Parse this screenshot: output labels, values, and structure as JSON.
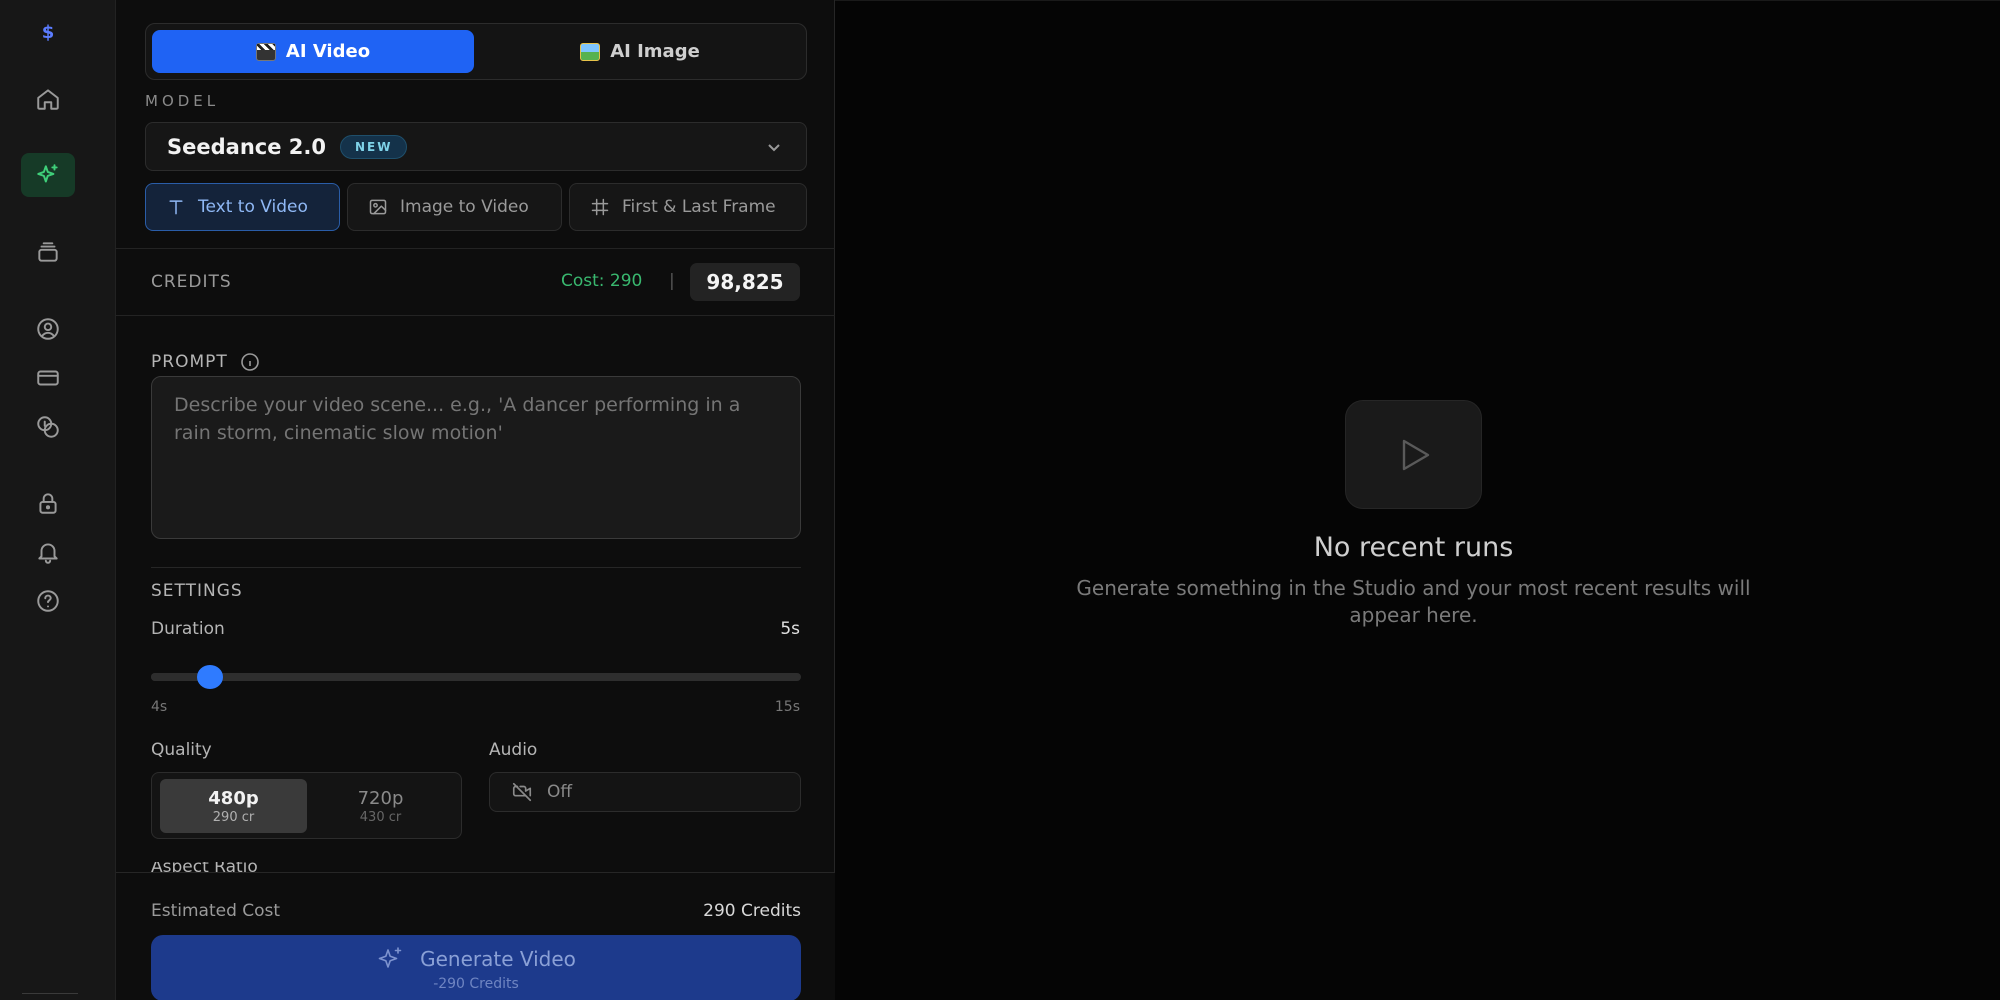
{
  "rail": {
    "logo": "$",
    "icons": [
      "home-icon",
      "sparkles-icon",
      "layers-icon",
      "user-circle-icon",
      "credit-card-icon",
      "coins-icon",
      "lock-icon",
      "bell-icon",
      "help-circle-icon"
    ],
    "active": "sparkles-icon",
    "active_color": "#3fd07a"
  },
  "mode_switch": {
    "video_label": "AI Video",
    "image_label": "AI Image",
    "active": "AI Video",
    "accent": "#1f63f4"
  },
  "model": {
    "section_label": "MODEL",
    "selected": "Seedance 2.0",
    "badge": "NEW"
  },
  "submodes": {
    "items": [
      "Text to Video",
      "Image to Video",
      "First & Last Frame"
    ],
    "active": "Text to Video"
  },
  "credits": {
    "label": "CREDITS",
    "cost": "Cost: 290",
    "separator": "|",
    "balance": "98,825"
  },
  "prompt": {
    "label": "PROMPT",
    "placeholder": "Describe your video scene... e.g., 'A dancer performing in a rain storm, cinematic slow motion'"
  },
  "settings": {
    "label": "SETTINGS",
    "duration": {
      "label": "Duration",
      "value": "5s",
      "min_label": "4s",
      "max_label": "15s",
      "level": 0.09
    },
    "quality": {
      "label": "Quality",
      "options": [
        {
          "label": "480p",
          "sub": "290 cr"
        },
        {
          "label": "720p",
          "sub": "430 cr"
        }
      ],
      "selected": "480p"
    },
    "audio": {
      "label": "Audio",
      "value": "Off"
    },
    "aspect_label": "Aspect Ratio"
  },
  "footer": {
    "est_label": "Estimated Cost",
    "est_value": "290 Credits",
    "generate_label": "Generate Video",
    "generate_sub": "-290 Credits"
  },
  "empty_state": {
    "title": "No recent runs",
    "subtitle": "Generate something in the Studio and your most recent results will appear here."
  }
}
